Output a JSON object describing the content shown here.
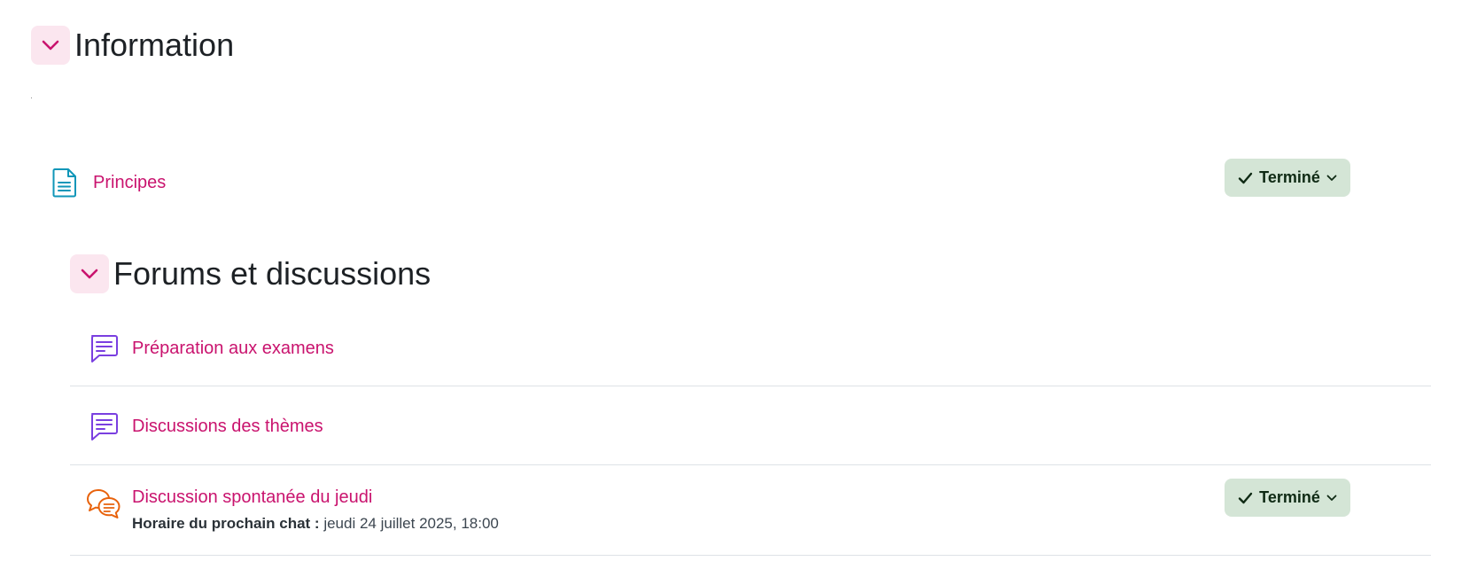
{
  "sections": [
    {
      "title": "Information",
      "activities": [
        {
          "name": "Principes",
          "icon": "page-icon",
          "completion": "Terminé"
        }
      ]
    },
    {
      "title": "Forums et discussions",
      "activities": [
        {
          "name": "Préparation aux examens",
          "icon": "forum-icon"
        },
        {
          "name": "Discussions des thèmes",
          "icon": "forum-icon"
        },
        {
          "name": "Discussion spontanée du jeudi",
          "icon": "chat-icon",
          "next_chat_label": "Horaire du prochain chat :",
          "next_chat_value": "jeudi 24 juillet 2025, 18:00",
          "completion": "Terminé"
        }
      ]
    }
  ],
  "colors": {
    "link": "#c9136e",
    "page_icon": "#0f96b8",
    "forum_icon": "#7a3fe0",
    "chat_icon": "#e8620c",
    "done_bg": "#d4e5d6",
    "collapse_bg": "#fbe6ef"
  }
}
